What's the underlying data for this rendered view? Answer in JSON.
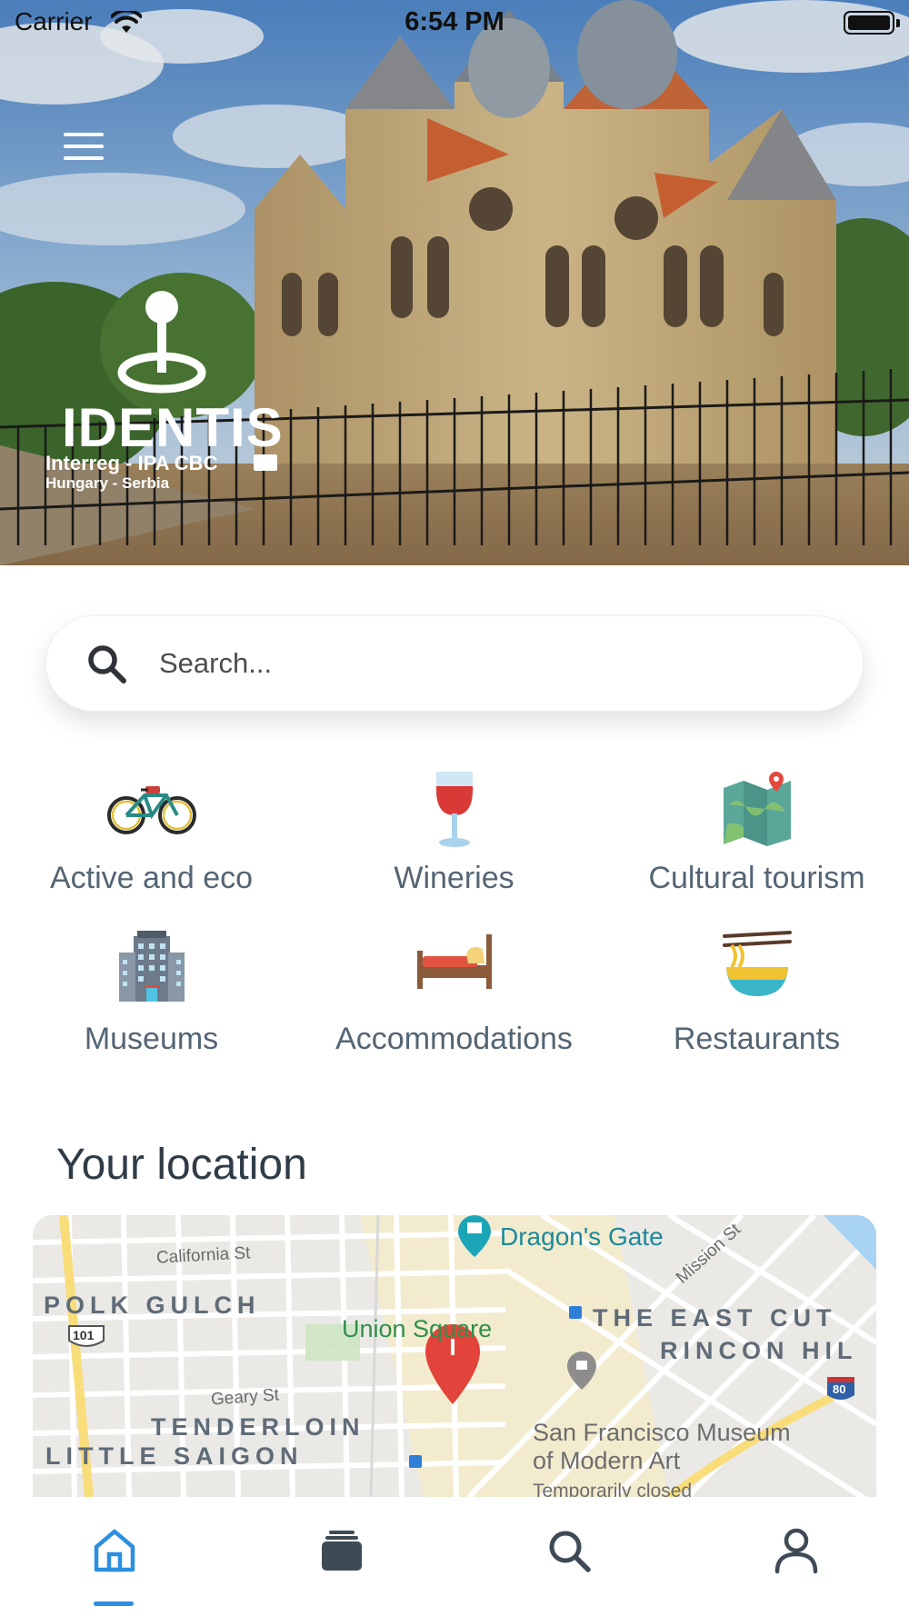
{
  "status_bar": {
    "carrier": "Carrier",
    "time": "6:54 PM"
  },
  "hero": {
    "logo_wordmark": "IDENTIS",
    "logo_line1": "Interreg - IPA CBC",
    "logo_line2": "Hungary - Serbia"
  },
  "search": {
    "placeholder": "Search..."
  },
  "categories": [
    {
      "label": "Active and eco",
      "icon": "bicycle-icon"
    },
    {
      "label": "Wineries",
      "icon": "wine-glass-icon"
    },
    {
      "label": "Cultural tourism",
      "icon": "map-icon"
    },
    {
      "label": "Museums",
      "icon": "building-icon"
    },
    {
      "label": "Accommodations",
      "icon": "bed-icon"
    },
    {
      "label": "Restaurants",
      "icon": "noodles-icon"
    }
  ],
  "location": {
    "title": "Your location",
    "map_labels": {
      "california_st": "California St",
      "polk_gulch": "POLK GULCH",
      "dragons_gate": "Dragon's Gate",
      "mission_st": "Mission St",
      "east_cut": "THE EAST CUT",
      "rincon_hill": "RINCON HIL",
      "union_square": "Union Square",
      "geary_st": "Geary St",
      "tenderloin": "TENDERLOIN",
      "little_saigon": "LITTLE SAIGON",
      "sfmoma_line1": "San Francisco Museum",
      "sfmoma_line2": "of Modern Art",
      "sfmoma_line3": "Temporarily closed",
      "shield_101": "101",
      "shield_80": "80"
    }
  },
  "tabbar": {
    "tabs": [
      {
        "name": "home",
        "icon": "home-icon",
        "active": true
      },
      {
        "name": "cards",
        "icon": "cards-icon",
        "active": false
      },
      {
        "name": "search",
        "icon": "search-icon",
        "active": false
      },
      {
        "name": "profile",
        "icon": "user-icon",
        "active": false
      }
    ],
    "active_color": "#2c8fe0",
    "inactive_color": "#3e4a55"
  }
}
